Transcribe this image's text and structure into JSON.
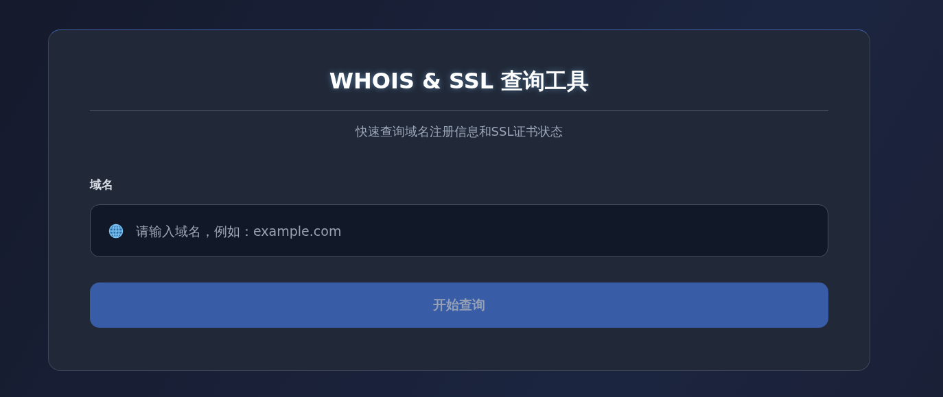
{
  "title": "WHOIS & SSL 查询工具",
  "subtitle": "快速查询域名注册信息和SSL证书状态",
  "domain_field": {
    "label": "域名",
    "placeholder": "请输入域名，例如：example.com"
  },
  "submit_button": {
    "label": "开始查询",
    "disabled": true
  }
}
